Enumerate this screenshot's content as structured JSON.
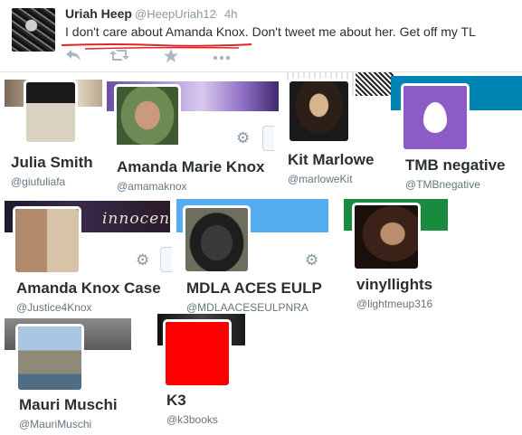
{
  "tweet": {
    "name": "Uriah Heep",
    "handle": "@HeepUriah12",
    "separator": "·",
    "time": "4h",
    "text": "I don't care about Amanda Knox. Don't tweet me about her. Get off my TL",
    "actions": {
      "reply_icon": "reply-icon",
      "retweet_icon": "retweet-icon",
      "favorite_icon": "favorite-icon",
      "more_icon": "more-icon"
    },
    "underline_color": "#e0262a"
  },
  "profiles": [
    {
      "name": "Julia Smith",
      "handle": "@giufuliafa"
    },
    {
      "name": "Amanda Marie Knox",
      "handle": "@amamaknox"
    },
    {
      "name": "Kit Marlowe",
      "handle": "@marloweKit"
    },
    {
      "name": "TMB negative",
      "handle": "@TMBnegative"
    },
    {
      "name": "Amanda Knox Case",
      "handle": "@Justice4Knox",
      "banner_text": "innocent"
    },
    {
      "name": "MDLA ACES EULP",
      "handle": "@MDLAACESEULPNRA"
    },
    {
      "name": "vinyllights",
      "handle": "@lightmeup316"
    },
    {
      "name": "Mauri Muschi",
      "handle": "@MauriMuschi"
    },
    {
      "name": "K3",
      "handle": "@k3books"
    }
  ],
  "colors": {
    "tmb_banner": "#0084b4",
    "mdla_banner": "#55acee",
    "vinyl_banner": "#1a8a3f",
    "k3_avatar": "#ff0000",
    "egg_avatar": "#8c5bc8"
  }
}
